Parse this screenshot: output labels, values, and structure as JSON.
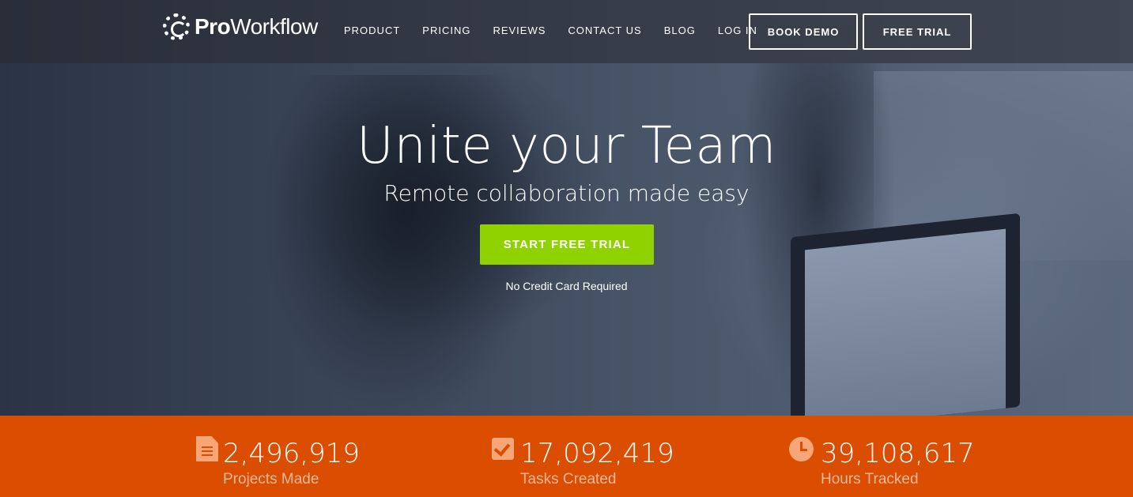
{
  "brand": {
    "name_bold": "Pro",
    "name_rest": "Workflow"
  },
  "nav": {
    "items": [
      "PRODUCT",
      "PRICING",
      "REVIEWS",
      "CONTACT US",
      "BLOG",
      "LOG IN"
    ],
    "book_demo": "BOOK DEMO",
    "free_trial": "FREE TRIAL"
  },
  "hero": {
    "title": "Unite your Team",
    "subtitle": "Remote collaboration made easy",
    "cta": "START FREE TRIAL",
    "note": "No Credit Card Required"
  },
  "stats": [
    {
      "icon": "document-icon",
      "value": "2,496,919",
      "label": "Projects Made"
    },
    {
      "icon": "checkbox-icon",
      "value": "17,092,419",
      "label": "Tasks Created"
    },
    {
      "icon": "clock-icon",
      "value": "39,108,617",
      "label": "Hours Tracked"
    }
  ],
  "colors": {
    "accent_green": "#8fd200",
    "stats_orange": "#db4d00",
    "stat_label": "#f5b89a"
  }
}
